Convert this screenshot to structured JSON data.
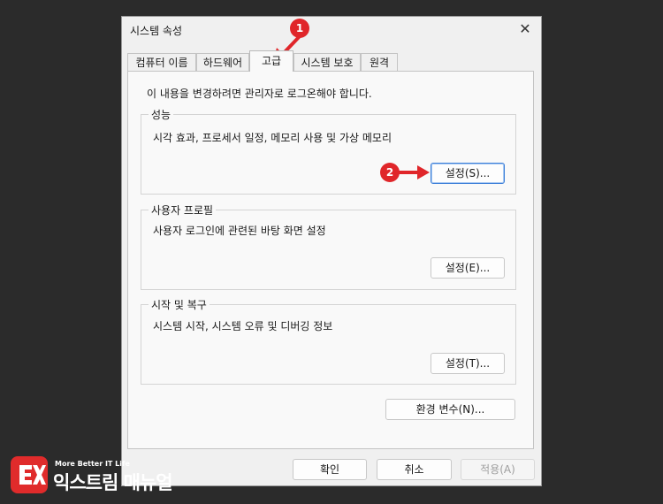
{
  "window": {
    "title": "시스템 속성",
    "close_icon": "✕"
  },
  "tabs": [
    {
      "label": "컴퓨터 이름",
      "active": false
    },
    {
      "label": "하드웨어",
      "active": false
    },
    {
      "label": "고급",
      "active": true
    },
    {
      "label": "시스템 보호",
      "active": false
    },
    {
      "label": "원격",
      "active": false
    }
  ],
  "intro": "이 내용을 변경하려면 관리자로 로그온해야 합니다.",
  "groups": {
    "performance": {
      "title": "성능",
      "description": "시각 효과, 프로세서 일정, 메모리 사용 및 가상 메모리",
      "button": "설정(S)..."
    },
    "user_profiles": {
      "title": "사용자 프로필",
      "description": "사용자 로그인에 관련된 바탕 화면 설정",
      "button": "설정(E)..."
    },
    "startup_recovery": {
      "title": "시작 및 복구",
      "description": "시스템 시작, 시스템 오류 및 디버깅 정보",
      "button": "설정(T)..."
    }
  },
  "env_button": "환경 변수(N)...",
  "footer": {
    "ok": "확인",
    "cancel": "취소",
    "apply": "적용(A)"
  },
  "annotations": [
    {
      "number": "1",
      "color": "#e0262a"
    },
    {
      "number": "2",
      "color": "#e0262a"
    }
  ],
  "watermark": {
    "sub": "More Better IT Life",
    "name": "익스트림 매뉴얼",
    "colors": {
      "mark": "#e02b2b",
      "text": "#ffffff"
    }
  }
}
